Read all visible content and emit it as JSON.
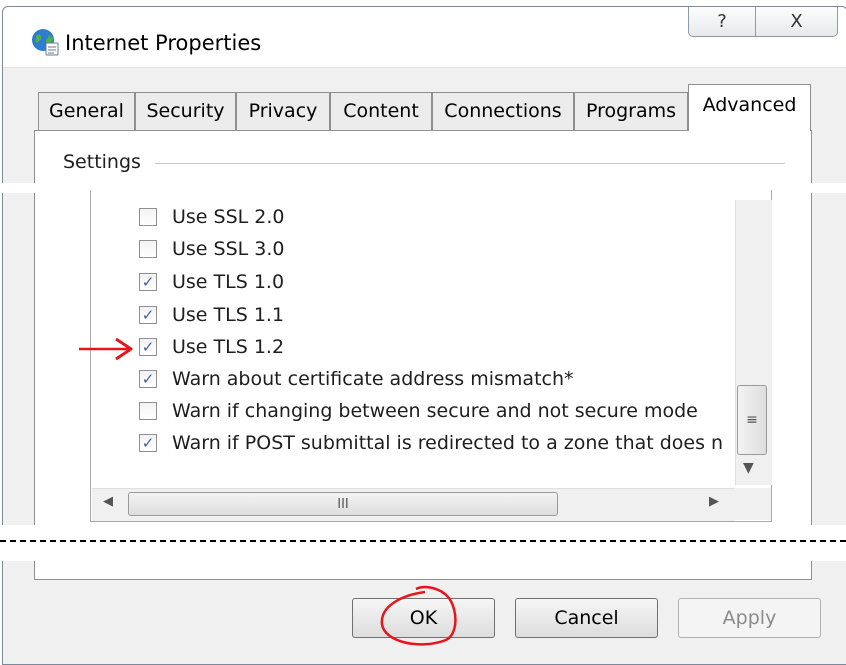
{
  "window": {
    "title": "Internet Properties",
    "help_symbol": "?",
    "close_symbol": "X"
  },
  "tabs": [
    {
      "label": "General",
      "active": false
    },
    {
      "label": "Security",
      "active": false
    },
    {
      "label": "Privacy",
      "active": false
    },
    {
      "label": "Content",
      "active": false
    },
    {
      "label": "Connections",
      "active": false
    },
    {
      "label": "Programs",
      "active": false
    },
    {
      "label": "Advanced",
      "active": true
    }
  ],
  "settings": {
    "group_label": "Settings",
    "items": [
      {
        "label": "Use SSL 2.0",
        "checked": false
      },
      {
        "label": "Use SSL 3.0",
        "checked": false
      },
      {
        "label": "Use TLS 1.0",
        "checked": true
      },
      {
        "label": "Use TLS 1.1",
        "checked": true
      },
      {
        "label": "Use TLS 1.2",
        "checked": true
      },
      {
        "label": "Warn about certificate address mismatch*",
        "checked": true
      },
      {
        "label": "Warn if changing between secure and not secure mode",
        "checked": false
      },
      {
        "label": "Warn if POST submittal is redirected to a zone that does n",
        "checked": true
      }
    ],
    "check_glyph": "✓"
  },
  "scrollbars": {
    "v_grip": "≡",
    "down_arrow": "▼",
    "left_arrow": "◀",
    "right_arrow": "▶",
    "h_grip": "III"
  },
  "buttons": {
    "ok": "OK",
    "cancel": "Cancel",
    "apply": "Apply"
  },
  "annotations": {
    "arrow_color": "#e8141c",
    "circle_color": "#e8141c"
  }
}
